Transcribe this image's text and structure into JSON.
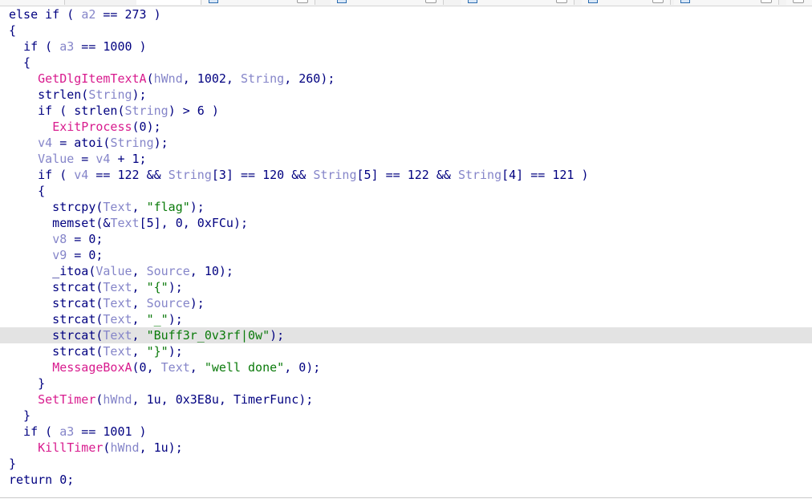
{
  "tabs": [
    {
      "label": ""
    },
    {
      "label": ""
    },
    {
      "label": ""
    },
    {
      "label": ""
    },
    {
      "label": ""
    },
    {
      "label": ""
    }
  ],
  "code_lines": [
    [
      [
        "kw",
        "else if ( "
      ],
      [
        "var",
        "a2"
      ],
      [
        "plain",
        " == 273 )"
      ]
    ],
    [
      [
        "plain",
        "{"
      ]
    ],
    [
      [
        "plain",
        "  "
      ],
      [
        "kw",
        "if ( "
      ],
      [
        "var",
        "a3"
      ],
      [
        "plain",
        " == 1000 )"
      ]
    ],
    [
      [
        "plain",
        "  {"
      ]
    ],
    [
      [
        "plain",
        "    "
      ],
      [
        "fn",
        "GetDlgItemTextA"
      ],
      [
        "plain",
        "("
      ],
      [
        "var",
        "hWnd"
      ],
      [
        "plain",
        ", 1002, "
      ],
      [
        "var",
        "String"
      ],
      [
        "plain",
        ", 260);"
      ]
    ],
    [
      [
        "plain",
        "    strlen("
      ],
      [
        "var",
        "String"
      ],
      [
        "plain",
        ");"
      ]
    ],
    [
      [
        "plain",
        "    if ( strlen("
      ],
      [
        "var",
        "String"
      ],
      [
        "plain",
        ") > 6 )"
      ]
    ],
    [
      [
        "plain",
        "      "
      ],
      [
        "fn",
        "ExitProcess"
      ],
      [
        "plain",
        "(0);"
      ]
    ],
    [
      [
        "plain",
        "    "
      ],
      [
        "var",
        "v4"
      ],
      [
        "plain",
        " = atoi("
      ],
      [
        "var",
        "String"
      ],
      [
        "plain",
        ");"
      ]
    ],
    [
      [
        "plain",
        "    "
      ],
      [
        "var",
        "Value"
      ],
      [
        "plain",
        " = "
      ],
      [
        "var",
        "v4"
      ],
      [
        "plain",
        " + 1;"
      ]
    ],
    [
      [
        "plain",
        "    if ( "
      ],
      [
        "var",
        "v4"
      ],
      [
        "plain",
        " == 122 && "
      ],
      [
        "var",
        "String"
      ],
      [
        "plain",
        "[3] == 120 && "
      ],
      [
        "var",
        "String"
      ],
      [
        "plain",
        "[5] == 122 && "
      ],
      [
        "var",
        "String"
      ],
      [
        "plain",
        "[4] == 121 )"
      ]
    ],
    [
      [
        "plain",
        "    {"
      ]
    ],
    [
      [
        "plain",
        "      strcpy("
      ],
      [
        "var",
        "Text"
      ],
      [
        "plain",
        ", "
      ],
      [
        "str",
        "\"flag\""
      ],
      [
        "plain",
        ");"
      ]
    ],
    [
      [
        "plain",
        "      memset(&"
      ],
      [
        "var",
        "Text"
      ],
      [
        "plain",
        "[5], 0, 0xFCu);"
      ]
    ],
    [
      [
        "plain",
        "      "
      ],
      [
        "var",
        "v8"
      ],
      [
        "plain",
        " = 0;"
      ]
    ],
    [
      [
        "plain",
        "      "
      ],
      [
        "var",
        "v9"
      ],
      [
        "plain",
        " = 0;"
      ]
    ],
    [
      [
        "plain",
        "      _itoa("
      ],
      [
        "var",
        "Value"
      ],
      [
        "plain",
        ", "
      ],
      [
        "var",
        "Source"
      ],
      [
        "plain",
        ", 10);"
      ]
    ],
    [
      [
        "plain",
        "      strcat("
      ],
      [
        "var",
        "Text"
      ],
      [
        "plain",
        ", "
      ],
      [
        "str",
        "\"{\""
      ],
      [
        "plain",
        ");"
      ]
    ],
    [
      [
        "plain",
        "      strcat("
      ],
      [
        "var",
        "Text"
      ],
      [
        "plain",
        ", "
      ],
      [
        "var",
        "Source"
      ],
      [
        "plain",
        ");"
      ]
    ],
    [
      [
        "plain",
        "      strcat("
      ],
      [
        "var",
        "Text"
      ],
      [
        "plain",
        ", "
      ],
      [
        "str",
        "\"_\""
      ],
      [
        "plain",
        ");"
      ]
    ],
    [
      [
        "plain",
        "      strcat("
      ],
      [
        "var",
        "Text"
      ],
      [
        "plain",
        ", "
      ],
      [
        "str",
        "\"Buff3r_0v3rf|0w\""
      ],
      [
        "plain",
        ");"
      ]
    ],
    [
      [
        "plain",
        "      strcat("
      ],
      [
        "var",
        "Text"
      ],
      [
        "plain",
        ", "
      ],
      [
        "str",
        "\"}\""
      ],
      [
        "plain",
        ");"
      ]
    ],
    [
      [
        "plain",
        "      "
      ],
      [
        "fn",
        "MessageBoxA"
      ],
      [
        "plain",
        "(0, "
      ],
      [
        "var",
        "Text"
      ],
      [
        "plain",
        ", "
      ],
      [
        "str",
        "\"well done\""
      ],
      [
        "plain",
        ", 0);"
      ]
    ],
    [
      [
        "plain",
        "    }"
      ]
    ],
    [
      [
        "plain",
        "    "
      ],
      [
        "fn",
        "SetTimer"
      ],
      [
        "plain",
        "("
      ],
      [
        "var",
        "hWnd"
      ],
      [
        "plain",
        ", 1u, 0x3E8u, TimerFunc);"
      ]
    ],
    [
      [
        "plain",
        "  }"
      ]
    ],
    [
      [
        "plain",
        "  if ( "
      ],
      [
        "var",
        "a3"
      ],
      [
        "plain",
        " == 1001 )"
      ]
    ],
    [
      [
        "plain",
        "    "
      ],
      [
        "fn",
        "KillTimer"
      ],
      [
        "plain",
        "("
      ],
      [
        "var",
        "hWnd"
      ],
      [
        "plain",
        ", 1u);"
      ]
    ],
    [
      [
        "plain",
        "}"
      ]
    ],
    [
      [
        "plain",
        "return 0;"
      ]
    ]
  ],
  "highlighted_line": 20,
  "colors": {
    "keyword": "#000080",
    "variable": "#8585c9",
    "function": "#d81b8e",
    "string": "#0a7a0a",
    "highlight": "#e3e3e3"
  }
}
